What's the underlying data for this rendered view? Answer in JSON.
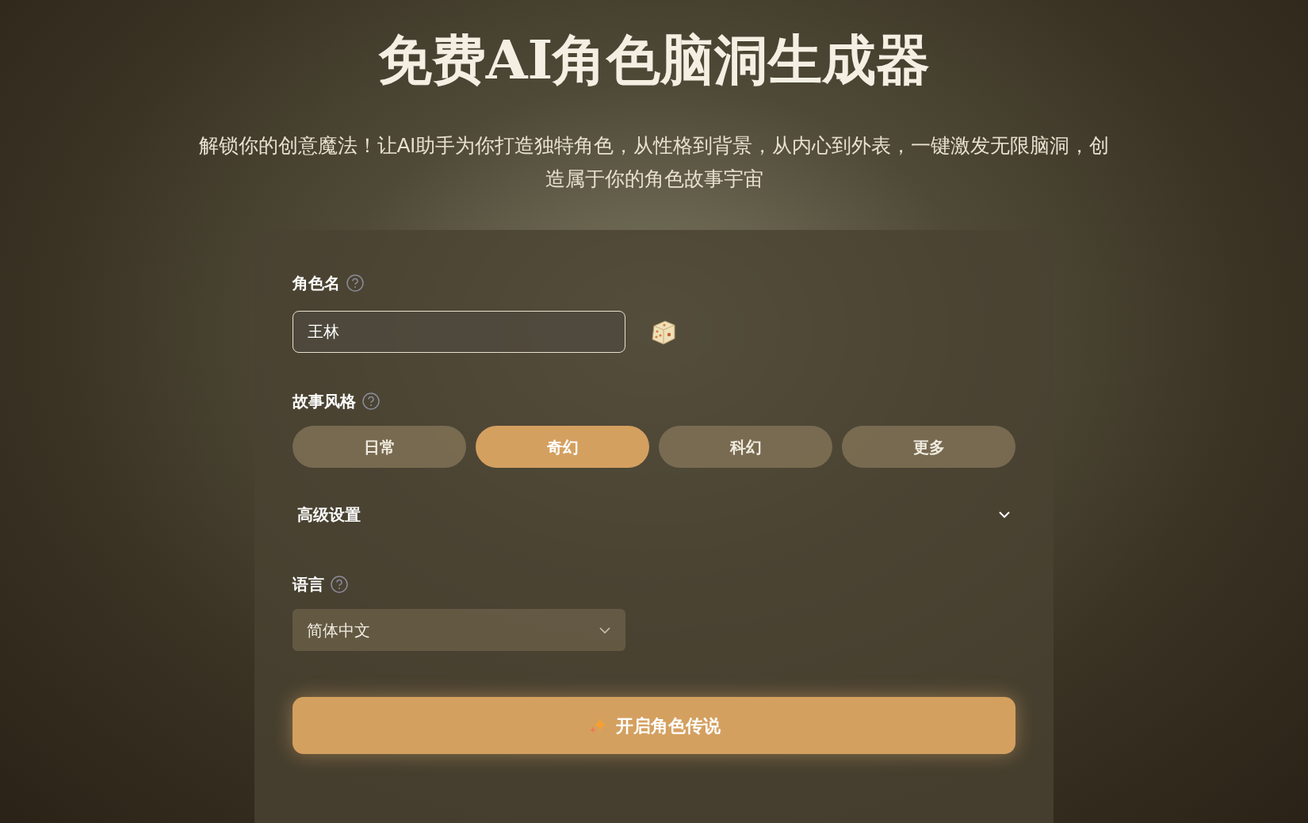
{
  "header": {
    "title": "免费AI角色脑洞生成器",
    "subtitle": "解锁你的创意魔法！让AI助手为你打造独特角色，从性格到背景，从内心到外表，一键激发无限脑洞，创造属于你的角色故事宇宙"
  },
  "form": {
    "name_field": {
      "label": "角色名",
      "value": "王林"
    },
    "story_style": {
      "label": "故事风格",
      "options": [
        {
          "label": "日常",
          "selected": false
        },
        {
          "label": "奇幻",
          "selected": true
        },
        {
          "label": "科幻",
          "selected": false
        },
        {
          "label": "更多",
          "selected": false
        }
      ]
    },
    "advanced": {
      "label": "高级设置",
      "expanded": false
    },
    "language": {
      "label": "语言",
      "value": "简体中文"
    },
    "submit": {
      "label": "开启角色传说"
    }
  }
}
